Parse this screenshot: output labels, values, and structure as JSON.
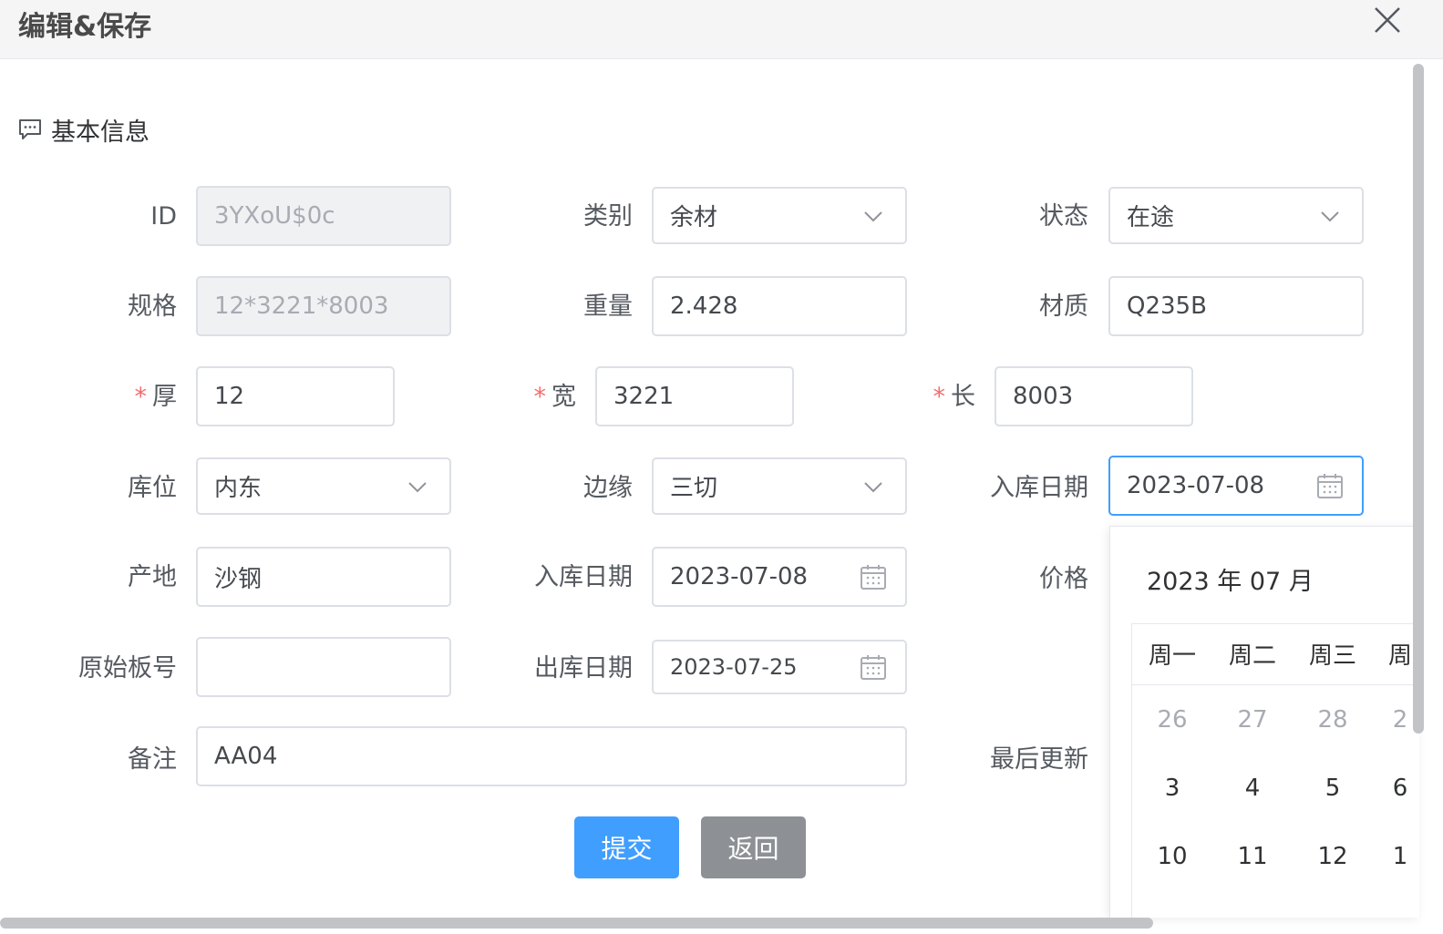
{
  "dialog": {
    "title": "编辑&保存"
  },
  "section": {
    "title": "基本信息"
  },
  "fields": {
    "id": {
      "label": "ID",
      "value": "3YXoU$0c"
    },
    "category": {
      "label": "类别",
      "value": "余材"
    },
    "status": {
      "label": "状态",
      "value": "在途"
    },
    "spec": {
      "label": "规格",
      "value": "12*3221*8003"
    },
    "weight": {
      "label": "重量",
      "value": "2.428"
    },
    "material": {
      "label": "材质",
      "value": "Q235B"
    },
    "thickness": {
      "label": "厚",
      "value": "12",
      "required_mark": "*"
    },
    "width": {
      "label": "宽",
      "value": "3221",
      "required_mark": "*"
    },
    "length": {
      "label": "长",
      "value": "8003",
      "required_mark": "*"
    },
    "location": {
      "label": "库位",
      "value": "内东"
    },
    "edge": {
      "label": "边缘",
      "value": "三切"
    },
    "inbound_date_right": {
      "label": "入库日期",
      "value": "2023-07-08"
    },
    "origin": {
      "label": "产地",
      "value": "沙钢"
    },
    "inbound_date": {
      "label": "入库日期",
      "value": "2023-07-08"
    },
    "price": {
      "label": "价格"
    },
    "original_plate_no": {
      "label": "原始板号",
      "value": ""
    },
    "outbound_date": {
      "label": "出库日期",
      "value": "2023-07-25"
    },
    "remark": {
      "label": "备注",
      "value": "AA04"
    },
    "last_update": {
      "label": "最后更新"
    }
  },
  "buttons": {
    "submit": "提交",
    "back": "返回"
  },
  "datepicker": {
    "caption": "2023 年 07 月",
    "weekdays": [
      "周一",
      "周二",
      "周三",
      "周"
    ],
    "rows": [
      [
        "26",
        "27",
        "28",
        "2"
      ],
      [
        "3",
        "4",
        "5",
        "6"
      ],
      [
        "10",
        "11",
        "12",
        "1"
      ]
    ]
  },
  "icons": {
    "chevron": "chevron-down-icon",
    "calendar": "calendar-icon",
    "comment": "comment-icon",
    "close": "close-icon"
  },
  "colors": {
    "primary": "#409eff",
    "danger": "#f56c6c",
    "gray_button": "#8d9094",
    "border": "#dcdfe6"
  }
}
